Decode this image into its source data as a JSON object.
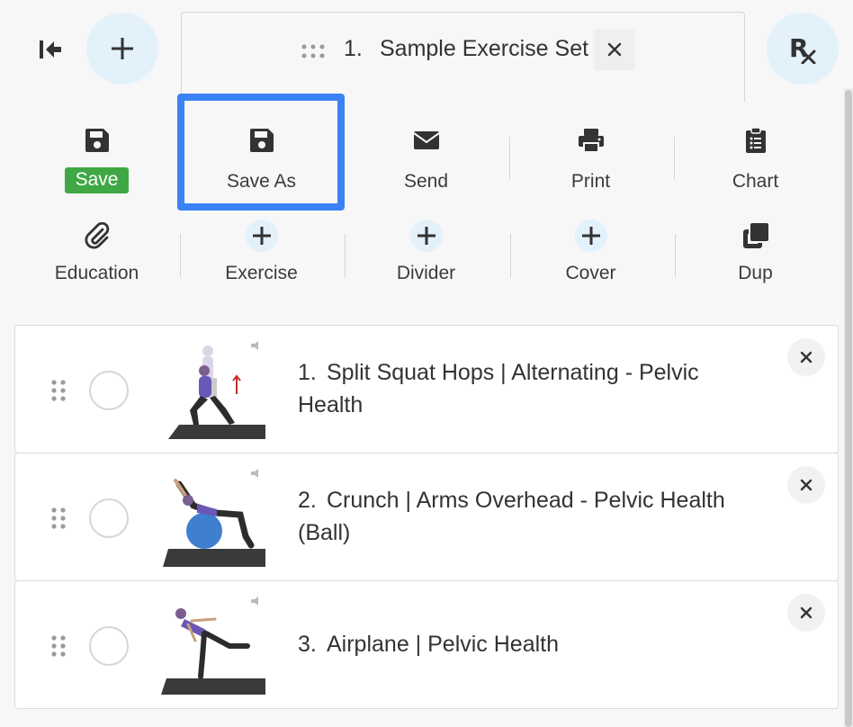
{
  "header": {
    "collapse_icon": "collapse-left-icon",
    "add_set_icon": "plus-icon",
    "set_tab": {
      "number": "1.",
      "title": "Sample Exercise Set",
      "drag_icon": "drag-handle-icon",
      "close_icon": "close-icon"
    },
    "rx_label": "Rx"
  },
  "toolbar": {
    "row1": [
      {
        "label": "Save",
        "icon": "floppy-disk-icon",
        "style": "badge",
        "badge_color": "#3fa845"
      },
      {
        "label": "Save As",
        "icon": "floppy-disk-icon",
        "highlighted": true
      },
      {
        "label": "Send",
        "icon": "envelope-icon"
      },
      {
        "label": "Print",
        "icon": "printer-icon"
      },
      {
        "label": "Chart",
        "icon": "clipboard-list-icon"
      }
    ],
    "row2": [
      {
        "label": "Education",
        "icon": "paperclip-icon"
      },
      {
        "label": "Exercise",
        "icon": "plus-icon"
      },
      {
        "label": "Divider",
        "icon": "plus-icon"
      },
      {
        "label": "Cover",
        "icon": "plus-icon"
      },
      {
        "label": "Dup",
        "icon": "duplicate-icon"
      }
    ],
    "highlight_color": "#3b82f6"
  },
  "exercises": [
    {
      "number": "1.",
      "title": "Split Squat Hops | Alternating - Pelvic Health",
      "thumb": "exercise-thumbnail-lunge"
    },
    {
      "number": "2.",
      "title": "Crunch | Arms Overhead - Pelvic Health (Ball)",
      "thumb": "exercise-thumbnail-ball-crunch"
    },
    {
      "number": "3.",
      "title": "Airplane | Pelvic Health",
      "thumb": "exercise-thumbnail-airplane"
    }
  ],
  "colors": {
    "accent": "#3b82f6",
    "save_green": "#3fa845",
    "circle_bg": "#e3f1fb"
  }
}
